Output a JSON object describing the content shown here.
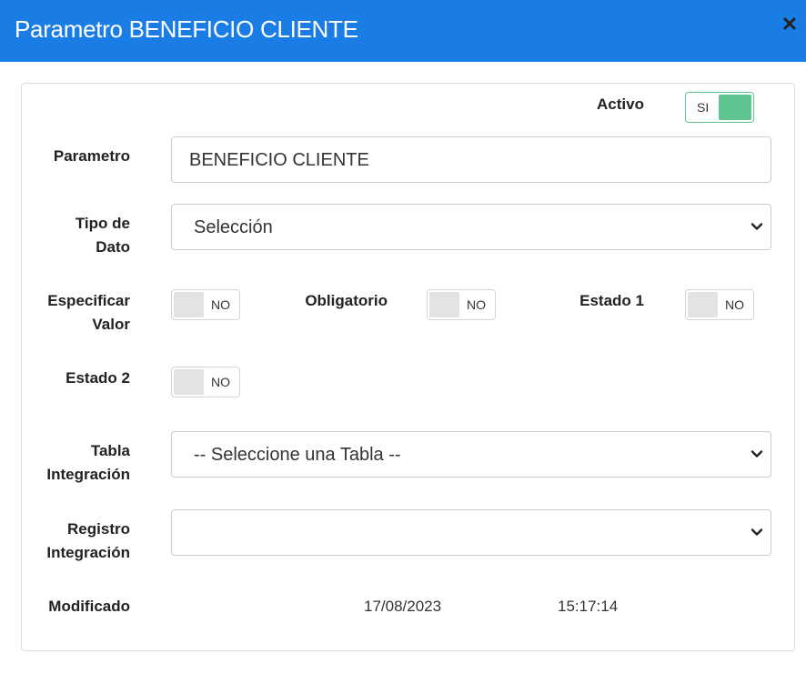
{
  "dialog": {
    "title": "Parametro BENEFICIO CLIENTE",
    "close_symbol": "✕"
  },
  "form": {
    "activo": {
      "label": "Activo",
      "state": "SI",
      "on": true
    },
    "parametro": {
      "label": "Parametro",
      "value": "BENEFICIO CLIENTE"
    },
    "tipo_dato": {
      "label_line1": "Tipo de",
      "label_line2": "Dato",
      "value": "Selección"
    },
    "especificar_valor": {
      "label_line1": "Especificar",
      "label_line2": "Valor",
      "state": "NO",
      "on": false
    },
    "obligatorio": {
      "label": "Obligatorio",
      "state": "NO",
      "on": false
    },
    "estado1": {
      "label": "Estado 1",
      "state": "NO",
      "on": false
    },
    "estado2": {
      "label": "Estado 2",
      "state": "NO",
      "on": false
    },
    "tabla_integracion": {
      "label_line1": "Tabla",
      "label_line2": "Integración",
      "value": "-- Seleccione una Tabla --"
    },
    "registro_integracion": {
      "label_line1": "Registro",
      "label_line2": "Integración",
      "value": ""
    },
    "modificado": {
      "label": "Modificado",
      "date": "17/08/2023",
      "time": "15:17:14"
    }
  },
  "icons": {
    "close": "close-icon",
    "dropdown": "chevron-down-icon"
  },
  "colors": {
    "header": "#1a7de6",
    "toggle_on": "#5fc48f",
    "toggle_off": "#e3e3e3"
  }
}
